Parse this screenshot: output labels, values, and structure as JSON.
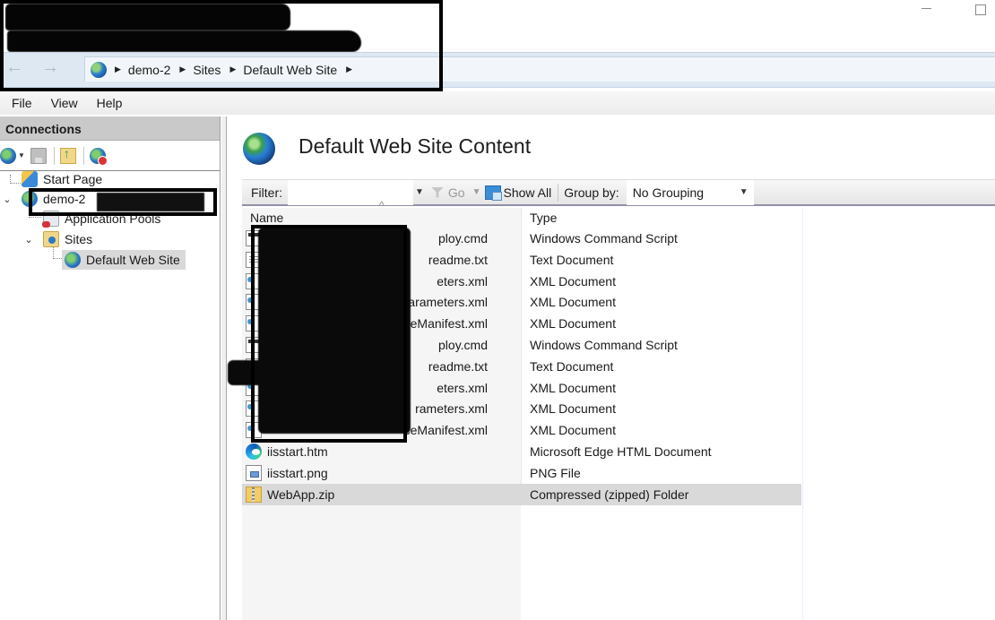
{
  "window": {
    "title": "",
    "controls": {
      "minimize": "—",
      "maximize": "☐"
    }
  },
  "address_bar": {
    "back_icon": "arrow-left-icon",
    "forward_icon": "arrow-right-icon",
    "breadcrumb": [
      "demo-2",
      "Sites",
      "Default Web Site"
    ],
    "separator": "▶"
  },
  "menu": {
    "items": [
      "File",
      "View",
      "Help"
    ]
  },
  "connections": {
    "header": "Connections",
    "toolbar": [
      "connect-icon",
      "save-icon",
      "up-folder-icon",
      "disconnect-icon"
    ],
    "tree": [
      {
        "label": "Start Page",
        "icon": "start-page-icon",
        "level": 1
      },
      {
        "label": "demo-2",
        "icon": "server-icon",
        "level": 0,
        "expanded": true
      },
      {
        "label": "Application Pools",
        "icon": "app-pools-icon",
        "level": 1
      },
      {
        "label": "Sites",
        "icon": "sites-folder-icon",
        "level": 1,
        "expanded": true
      },
      {
        "label": "Default Web Site",
        "icon": "globe-icon",
        "level": 2,
        "selected": true
      }
    ]
  },
  "main": {
    "title": "Default Web Site Content",
    "filter": {
      "label": "Filter:",
      "value": "",
      "go_label": "Go",
      "show_all_label": "Show All",
      "group_by_label": "Group by:",
      "group_by_value": "No Grouping"
    },
    "columns": {
      "name": "Name",
      "type": "Type"
    },
    "files": [
      {
        "name": "ploy.cmd",
        "type": "Windows Command Script",
        "icon": "cmd"
      },
      {
        "name": "readme.txt",
        "type": "Text Document",
        "icon": "txt"
      },
      {
        "name": "eters.xml",
        "type": "XML Document",
        "icon": "xml"
      },
      {
        "name": ".SetParameters.xml",
        "type": "XML Document",
        "icon": "xml"
      },
      {
        "name": "Client.SourceManifest.xml",
        "type": "XML Document",
        "icon": "xml"
      },
      {
        "name": "ploy.cmd",
        "type": "Windows Command Script",
        "icon": "cmd"
      },
      {
        "name": "readme.txt",
        "type": "Text Document",
        "icon": "txt"
      },
      {
        "name": "eters.xml",
        "type": "XML Document",
        "icon": "xml"
      },
      {
        "name": "rameters.xml",
        "type": "XML Document",
        "icon": "xml"
      },
      {
        "name": "ceManifest.xml",
        "type": "XML Document",
        "icon": "xml"
      },
      {
        "name": "iisstart.htm",
        "type": "Microsoft Edge HTML Document",
        "icon": "edge"
      },
      {
        "name": "iisstart.png",
        "type": "PNG File",
        "icon": "png"
      },
      {
        "name": "WebApp.zip",
        "type": "Compressed (zipped) Folder",
        "icon": "zip",
        "selected": true
      }
    ]
  }
}
